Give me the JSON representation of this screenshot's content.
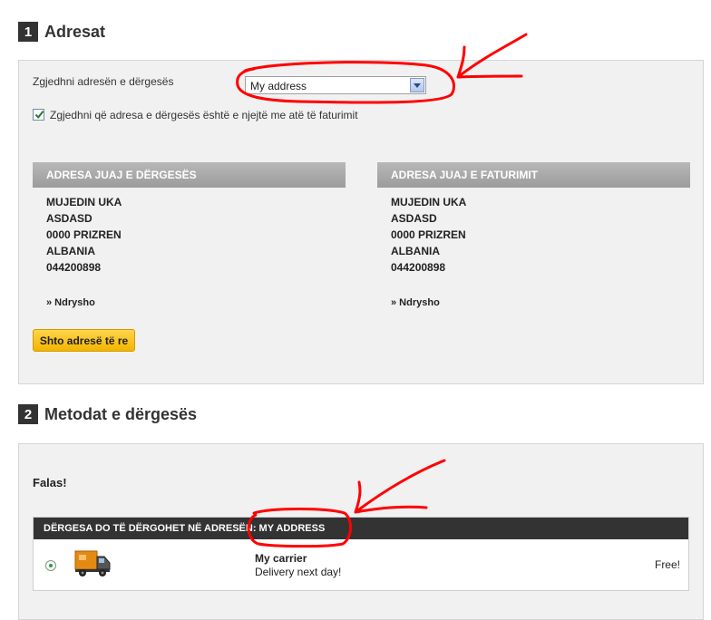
{
  "step1": {
    "number": "1",
    "title": "Adresat"
  },
  "delivery_select": {
    "label": "Zgjedhni adresën e dërgesës",
    "value": "My address"
  },
  "same_address": {
    "label": "Zgjedhni që adresa e dërgesës është e njejtë me atë të faturimit",
    "checked": true
  },
  "delivery_address": {
    "title": "ADRESA JUAJ E DËRGESËS",
    "lines": [
      "MUJEDIN UKA",
      "ASDASD",
      "0000 PRIZREN",
      "ALBANIA",
      "044200898"
    ],
    "change_label": "» Ndrysho"
  },
  "invoice_address": {
    "title": "ADRESA JUAJ E FATURIMIT",
    "lines": [
      "MUJEDIN UKA",
      "ASDASD",
      "0000 PRIZREN",
      "ALBANIA",
      "044200898"
    ],
    "change_label": "» Ndrysho"
  },
  "add_address_button": "Shto adresë të re",
  "step2": {
    "number": "2",
    "title": "Metodat e dërgesës"
  },
  "free_label": "Falas!",
  "shipping": {
    "header": "DËRGESA DO TË DËRGOHET NË ADRESËN: MY ADDRESS",
    "carrier_name": "My carrier",
    "carrier_delay": "Delivery next day!",
    "price": "Free!",
    "selected": true,
    "icon": "truck-icon"
  },
  "colors": {
    "accent_button": "#f3b500",
    "header_dark": "#333333",
    "annotation": "#ff0000"
  }
}
